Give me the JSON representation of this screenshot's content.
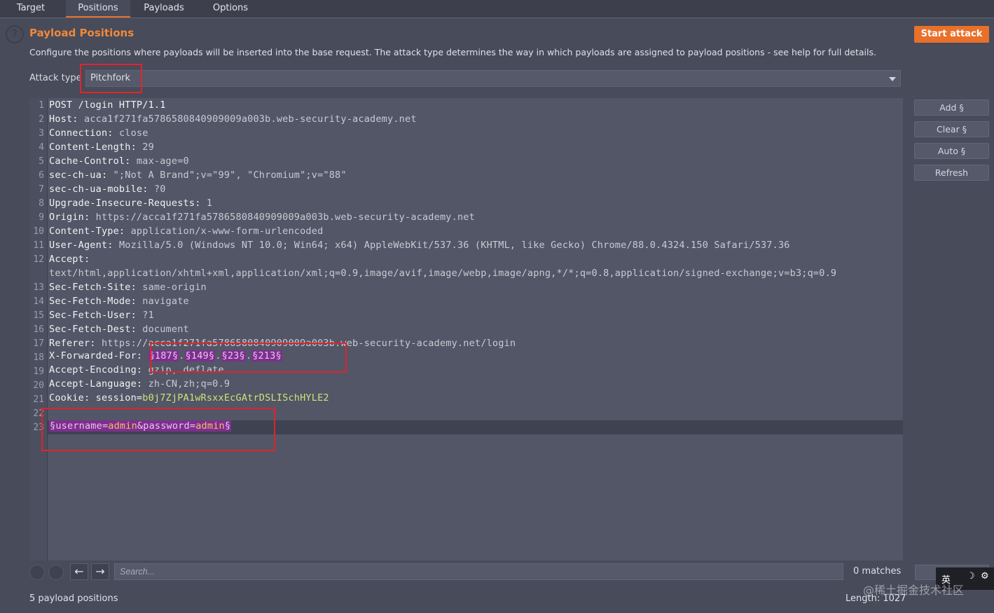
{
  "tabs": [
    "Target",
    "Positions",
    "Payloads",
    "Options"
  ],
  "active_tab": "Positions",
  "header": {
    "title": "Payload Positions",
    "description": "Configure the positions where payloads will be inserted into the base request. The attack type determines the way in which payloads are assigned to payload positions - see help for full details.",
    "start_attack": "Start attack",
    "help_icon": "question-circle-icon"
  },
  "attack_type": {
    "label": "Attack type",
    "value": "Pitchfork"
  },
  "side_buttons": {
    "add": "Add §",
    "clear": "Clear §",
    "auto": "Auto §",
    "refresh": "Refresh"
  },
  "request": {
    "line_numbers": [
      "1",
      "2",
      "3",
      "4",
      "5",
      "6",
      "7",
      "8",
      "9",
      "10",
      "11",
      "12",
      "13",
      "14",
      "15",
      "16",
      "17",
      "18",
      "19",
      "20",
      "21",
      "22",
      "23"
    ],
    "lines": [
      {
        "k": "POST /login HTTP/1.1",
        "v": ""
      },
      {
        "k": "Host: ",
        "v": "acca1f271fa5786580840909009a003b.web-security-academy.net"
      },
      {
        "k": "Connection: ",
        "v": "close"
      },
      {
        "k": "Content-Length: ",
        "v": "29"
      },
      {
        "k": "Cache-Control: ",
        "v": "max-age=0"
      },
      {
        "k": "sec-ch-ua: ",
        "v": "\";Not A Brand\";v=\"99\", \"Chromium\";v=\"88\""
      },
      {
        "k": "sec-ch-ua-mobile: ",
        "v": "?0"
      },
      {
        "k": "Upgrade-Insecure-Requests: ",
        "v": "1"
      },
      {
        "k": "Origin: ",
        "v": "https://acca1f271fa5786580840909009a003b.web-security-academy.net"
      },
      {
        "k": "Content-Type: ",
        "v": "application/x-www-form-urlencoded"
      },
      {
        "k": "User-Agent: ",
        "v": "Mozilla/5.0 (Windows NT 10.0; Win64; x64) AppleWebKit/537.36 (KHTML, like Gecko) Chrome/88.0.4324.150 Safari/537.36"
      },
      {
        "k": "Accept: ",
        "v": ""
      },
      {
        "k": "",
        "v": "text/html,application/xhtml+xml,application/xml;q=0.9,image/avif,image/webp,image/apng,*/*;q=0.8,application/signed-exchange;v=b3;q=0.9"
      },
      {
        "k": "Sec-Fetch-Site: ",
        "v": "same-origin"
      },
      {
        "k": "Sec-Fetch-Mode: ",
        "v": "navigate"
      },
      {
        "k": "Sec-Fetch-User: ",
        "v": "?1"
      },
      {
        "k": "Sec-Fetch-Dest: ",
        "v": "document"
      },
      {
        "k": "Referer: ",
        "v": "https://acca1f271fa5786580840909009a003b.web-security-academy.net/login"
      }
    ],
    "xff_key": "X-Forwarded-For: ",
    "xff_markers": [
      "§187§",
      "§149§",
      "§23§",
      "§213§"
    ],
    "xff_sep": ".",
    "after_lines": [
      {
        "k": "Accept-Encoding: ",
        "v": "gzip, deflate"
      },
      {
        "k": "Accept-Language: ",
        "v": "zh-CN,zh;q=0.9"
      }
    ],
    "cookie_key": "Cookie: session=",
    "cookie_val": "b0j7ZjPA1wRsxxEcGAtrDSLISchHYLE2",
    "body": {
      "open": "§",
      "k1": "username=",
      "v1": "admin",
      "k2": "&password=",
      "v2": "admin",
      "close": "§"
    }
  },
  "search": {
    "placeholder": "Search...",
    "matches": "0 matches"
  },
  "status": {
    "positions": "5 payload positions",
    "length": "Length: 1027"
  },
  "overlay": {
    "ime": "英",
    "watermark": "@稀土掘金技术社区"
  }
}
